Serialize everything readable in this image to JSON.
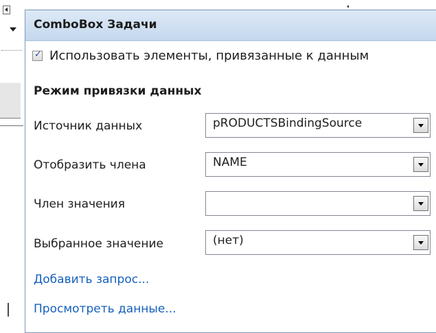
{
  "panel": {
    "title": "ComboBox Задачи",
    "use_data_bound_items": {
      "label": "Использовать элементы, привязанные к данным",
      "checked": true
    },
    "section_title": "Режим привязки данных",
    "fields": [
      {
        "label": "Источник данных",
        "value": "pRODUCTSBindingSource"
      },
      {
        "label": "Отобразить члена",
        "value": "NAME"
      },
      {
        "label": "Член значения",
        "value": ""
      },
      {
        "label": "Выбранное значение",
        "value": "(нет)"
      }
    ],
    "links": [
      {
        "label": "Добавить запрос..."
      },
      {
        "label": "Просмотреть данные..."
      }
    ]
  },
  "colors": {
    "header_gradient_top": "#dde9f6",
    "header_gradient_bottom": "#c4d8ee",
    "panel_border": "#7a99b9",
    "link": "#1560bd"
  },
  "icons": {
    "checkbox_mark": "✓",
    "dropdown_arrow": "chevron-down-icon",
    "smart_tag_glyph": "smart-tag-icon"
  }
}
